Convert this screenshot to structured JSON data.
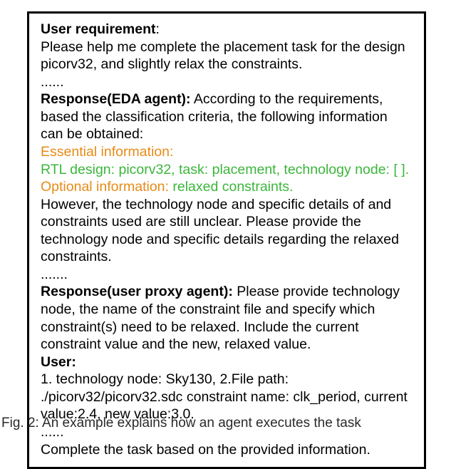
{
  "transcript": {
    "user_req_label": "User requirement",
    "user_req_text": "Please help me complete the placement task for the design picorv32, and slightly relax the constraints.",
    "dots1": "......",
    "resp_eda_label": "Response(EDA agent):",
    "resp_eda_intro": " According to the requirements, based the classification criteria, the following information can be obtained:",
    "essential_label": "Essential information:",
    "rtl_line": "RTL design: picorv32, task: placement, technology node: [ ].",
    "optional_label": "Optional information:",
    "optional_value": " relaxed constraints.",
    "however_text": "However, the technology node and specific details of and constraints used are still unclear. Please provide the technology node and specific details regarding the relaxed constraints.",
    "dots2": ".......",
    "resp_proxy_label": "Response(user proxy agent):",
    "resp_proxy_text": " Please provide technology node, the name of the constraint file and specify which constraint(s) need to be relaxed. Include the current constraint value and the new, relaxed value.",
    "user_label": "User:",
    "user_line1": "1. technology node: Sky130, 2.File path: ./picorv32/picorv32.sdc constraint name: clk_period, current value:2.4, new value:3.0.",
    "dots3": "......",
    "complete_line": "Complete the task based on the provided information."
  },
  "caption": {
    "label": "Fig. 2:",
    "text": " An example explains how an agent executes the task"
  }
}
